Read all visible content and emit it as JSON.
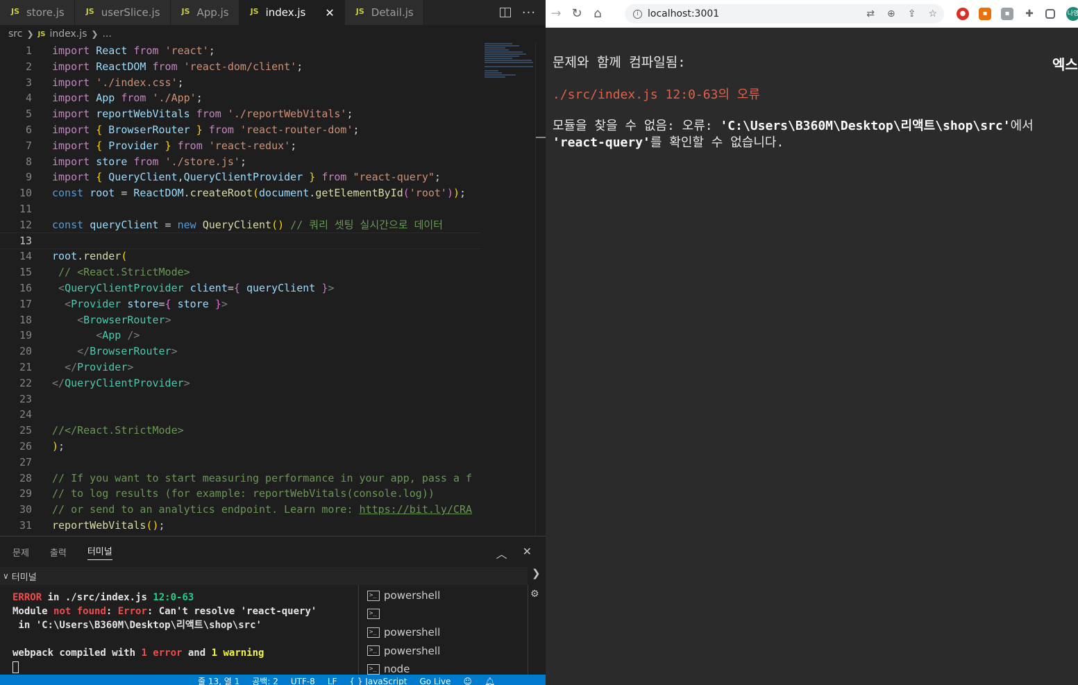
{
  "editor": {
    "tabs": [
      {
        "label": "store.js",
        "active": false
      },
      {
        "label": "userSlice.js",
        "active": false
      },
      {
        "label": "App.js",
        "active": false
      },
      {
        "label": "index.js",
        "active": true
      },
      {
        "label": "Detail.js",
        "active": false
      }
    ],
    "tab_badge": "JS",
    "breadcrumb": {
      "folder": "src",
      "file": "index.js",
      "more": "..."
    },
    "current_line": 13
  },
  "panel": {
    "tabs": [
      "문제",
      "출력",
      "터미널"
    ],
    "active_tab": "터미널",
    "terminal_header": "터미널",
    "terminal_output": {
      "l1_a": "ERROR",
      "l1_b": " in ./src/index.js ",
      "l1_c": "12:0-63",
      "l2_a": "Module ",
      "l2_b": "not found",
      "l2_c": ": ",
      "l2_d": "Error",
      "l2_e": ": Can't resolve 'react-query'",
      "l3": " in 'C:\\Users\\B360M\\Desktop\\리액트\\shop\\src'",
      "l5_a": "webpack compiled with ",
      "l5_b": "1 error",
      "l5_c": " and ",
      "l5_d": "1 warning"
    },
    "terminals": [
      "powershell",
      "",
      "powershell",
      "powershell",
      "node"
    ]
  },
  "statusbar": {
    "position": "줄 13, 열 1",
    "indent": "공백: 2",
    "encoding": "UTF-8",
    "eol": "LF",
    "language": "{ } JavaScript",
    "golive": "Go Live"
  },
  "browser": {
    "url": "localhost:3001",
    "overlay": {
      "title": "문제와 함께 컴파일됨:",
      "close_label": "엑스",
      "file": "./src/index.js 12:0-63의 오류",
      "msg_a": "모듈을 찾을 수 없음: 오류: ",
      "msg_b": "'C:\\Users\\B360M\\Desktop\\리액트\\shop\\src'",
      "msg_c": "에서",
      "msg_d": "'react-query'",
      "msg_e": "를 확인할 수 없습니다."
    },
    "avatar_text": "나영"
  },
  "colors": {
    "vscode_bg": "#1e1e1e",
    "statusbar": "#007acc",
    "overlay_bg": "#2b2b2b",
    "error_red": "#e36049"
  }
}
